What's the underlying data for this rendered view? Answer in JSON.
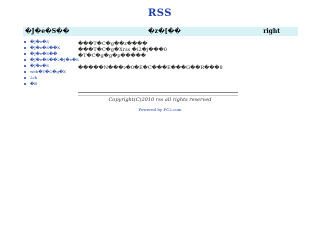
{
  "header": {
    "title": "RSS"
  },
  "nav": {
    "left": "�J�e�S��",
    "middle": "�z�[��",
    "right": "right"
  },
  "sidebar": {
    "items": [
      {
        "label": "�J�e�S"
      },
      {
        "label": "�J�e�S��X"
      },
      {
        "label": "�J�e�S��"
      },
      {
        "label": "�J�e�S��2�J�e�S"
      },
      {
        "label": "�J�e�S"
      },
      {
        "label": "web�T�C�g�X"
      },
      {
        "label": "2ch"
      },
      {
        "label": "�B"
      }
    ]
  },
  "main": {
    "lines": [
      "���T�C�g��z����",
      "���T�C�g�Xrss �i2�j���0",
      "�T�C�g�g�p�����",
      "�����N���ɂ�0�E�C���E���G��R���8"
    ]
  },
  "footer": {
    "copyright": "Copyright(C)2010 rss all rights reserved",
    "powered": "Powered by FC2.com"
  }
}
